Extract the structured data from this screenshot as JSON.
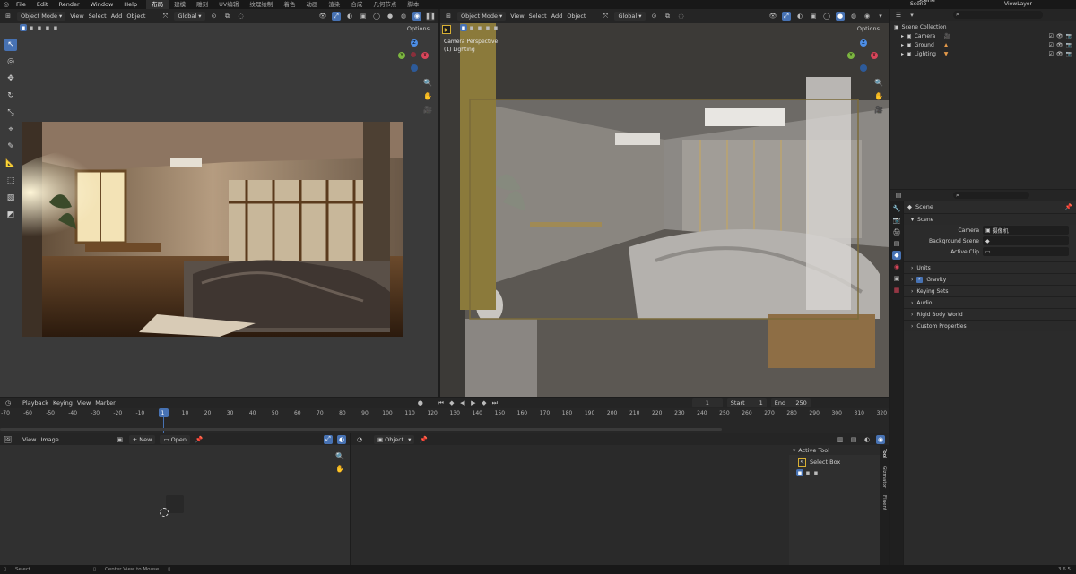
{
  "topbar": {
    "menus": [
      "File",
      "Edit",
      "Render",
      "Window",
      "Help"
    ],
    "workspace_tabs": [
      "布局",
      "建模",
      "雕刻",
      "UV编辑",
      "纹理绘制",
      "着色",
      "动画",
      "渲染",
      "合成",
      "几何节点",
      "脚本"
    ],
    "active_tab_index": 0,
    "scene_label": "Scene",
    "viewlayer_label": "ViewLayer"
  },
  "left_viewport": {
    "mode": "Object Mode",
    "menus": [
      "View",
      "Select",
      "Add",
      "Object"
    ],
    "transform": "Global",
    "options": "Options"
  },
  "right_viewport": {
    "mode": "Object Mode",
    "menus": [
      "View",
      "Select",
      "Add",
      "Object"
    ],
    "transform": "Global",
    "options": "Options",
    "overlay_line1": "Camera Perspective",
    "overlay_line2": "(1) Lighting"
  },
  "gizmo": {
    "z": "Z",
    "y": "Y",
    "x": "X"
  },
  "outliner": {
    "root": "Scene Collection",
    "items": [
      {
        "name": "Camera"
      },
      {
        "name": "Ground"
      },
      {
        "name": "Lighting"
      }
    ]
  },
  "properties": {
    "context": "Scene",
    "section_scene": "Scene",
    "camera_label": "Camera",
    "camera_value": "摄像机",
    "bg_scene_label": "Background Scene",
    "active_clip_label": "Active Clip",
    "sections": [
      "Units",
      "Gravity",
      "Keying Sets",
      "Audio",
      "Rigid Body World",
      "Custom Properties"
    ]
  },
  "timeline": {
    "menus": [
      "Playback",
      "Keying",
      "View",
      "Marker"
    ],
    "current_frame": "1",
    "start_label": "Start",
    "start_value": "1",
    "end_label": "End",
    "end_value": "250",
    "ruler": [
      "-70",
      "-60",
      "-50",
      "-40",
      "-30",
      "-20",
      "-10",
      "1",
      "10",
      "20",
      "30",
      "40",
      "50",
      "60",
      "70",
      "80",
      "90",
      "100",
      "110",
      "120",
      "130",
      "140",
      "150",
      "160",
      "170",
      "180",
      "190",
      "200",
      "210",
      "220",
      "230",
      "240",
      "250",
      "260",
      "270",
      "280",
      "290",
      "300",
      "310",
      "320"
    ]
  },
  "image_editor": {
    "menus": [
      "View",
      "Image"
    ],
    "new_label": "New",
    "open_label": "Open"
  },
  "node_editor": {
    "type_label": "Object",
    "active_tool_title": "Active Tool",
    "select_box_label": "Select Box",
    "side_tabs": [
      "Tool",
      "Gizmator",
      "Fluent"
    ]
  },
  "statusbar": {
    "select": "Select",
    "center_view": "Center View to Mouse",
    "version": "3.6.5"
  },
  "colors": {
    "accent": "#4772b3",
    "camera_frame": "#d8b034",
    "gizmo_x": "#d9455a",
    "gizmo_y": "#7cb640",
    "gizmo_z": "#4d8ee6"
  }
}
